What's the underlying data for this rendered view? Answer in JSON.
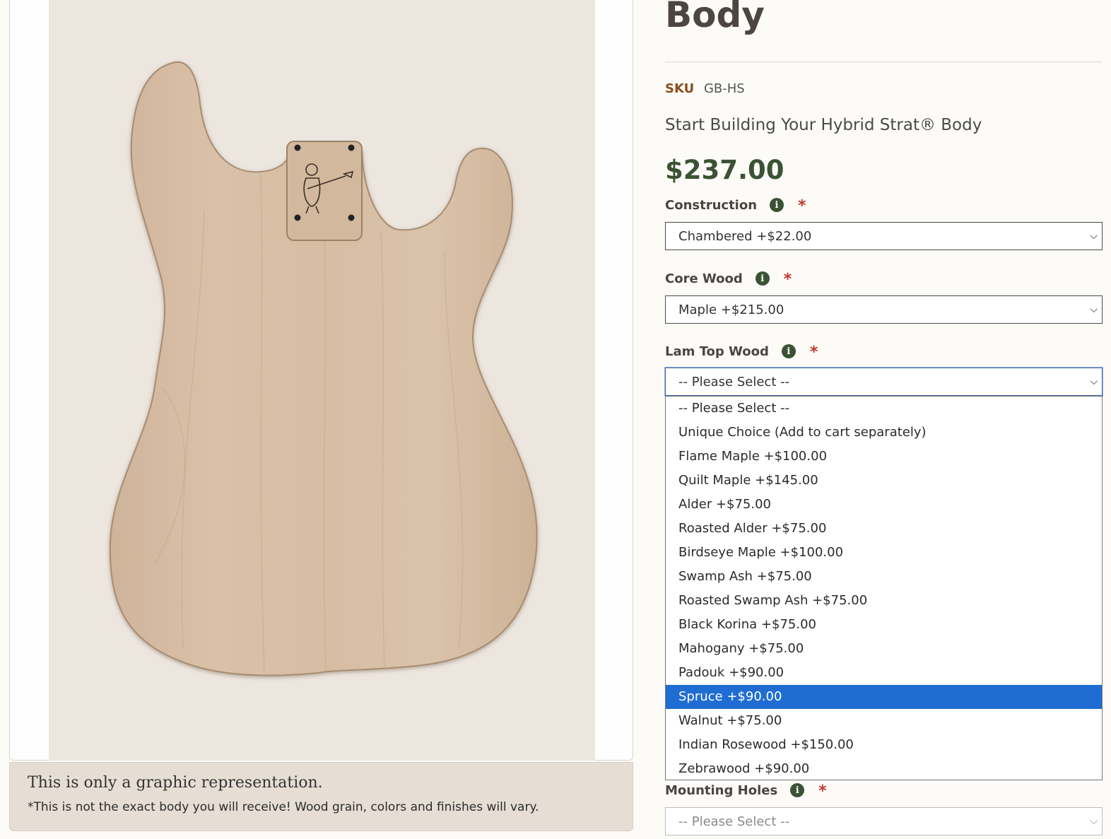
{
  "product": {
    "title": "Body",
    "sku_label": "SKU",
    "sku": "GB-HS",
    "subtitle": "Start Building Your Hybrid Strat® Body",
    "price": "$237.00"
  },
  "image_panel": {
    "caption_title": "This is only a graphic representation.",
    "caption_note": "*This is not the exact body you will receive! Wood grain, colors and finishes will vary."
  },
  "options": {
    "construction": {
      "label": "Construction",
      "required": "*",
      "value": "Chambered +$22.00"
    },
    "core_wood": {
      "label": "Core Wood",
      "required": "*",
      "value": "Maple +$215.00"
    },
    "lam_top_wood": {
      "label": "Lam Top Wood",
      "required": "*",
      "value": "-- Please Select --",
      "options": [
        "-- Please Select --",
        "Unique Choice (Add to cart separately)",
        "Flame Maple +$100.00",
        "Quilt Maple +$145.00",
        "Alder +$75.00",
        "Roasted Alder +$75.00",
        "Birdseye Maple +$100.00",
        "Swamp Ash +$75.00",
        "Roasted Swamp Ash +$75.00",
        "Black Korina +$75.00",
        "Mahogany +$75.00",
        "Padouk +$90.00",
        "Spruce +$90.00",
        "Walnut +$75.00",
        "Indian Rosewood +$150.00",
        "Zebrawood +$90.00"
      ],
      "highlighted": "Spruce +$90.00"
    },
    "mounting_holes": {
      "label": "Mounting Holes",
      "required": "*",
      "value": "-- Please Select --"
    }
  },
  "icons": {
    "info": "info-icon",
    "chevron": "chevron-down-icon"
  },
  "colors": {
    "price": "#3b5335",
    "sku_label": "#8a4e1e",
    "required": "#c0392b",
    "highlight": "#1f6dd2"
  }
}
